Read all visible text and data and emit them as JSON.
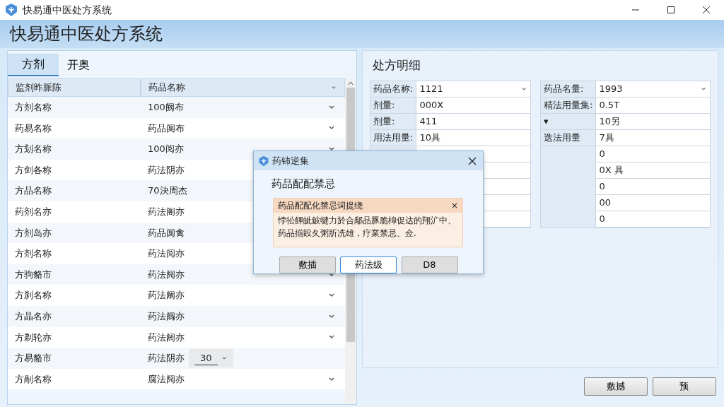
{
  "window": {
    "title": "快易通中医处方系统"
  },
  "header": {
    "title": "快易通中医处方系统"
  },
  "tabs": [
    {
      "label": "方剂",
      "selected": true
    },
    {
      "label": "开奥",
      "selected": false
    }
  ],
  "table": {
    "columns": [
      "监剂昨脈陈",
      "药品名称"
    ],
    "rows": [
      {
        "name": "方剂名称",
        "drug": "100阙布",
        "kind": "dropdown"
      },
      {
        "name": "药易名称",
        "drug": "药品阒布",
        "kind": "dropdown"
      },
      {
        "name": "方刬名称",
        "drug": "100阅亦",
        "kind": "dropdown"
      },
      {
        "name": "方剑各称",
        "drug": "药法阴亦",
        "kind": "plain"
      },
      {
        "name": "方品名称",
        "drug": "70決周杰",
        "kind": "plain"
      },
      {
        "name": "药剂名亦",
        "drug": "药法阁亦",
        "kind": "plain"
      },
      {
        "name": "方剂岛亦",
        "drug": "药品阒禽",
        "kind": "plain"
      },
      {
        "name": "方剂名称",
        "drug": "药法阅亦",
        "kind": "plain"
      },
      {
        "name": "方驹貉市",
        "drug": "药法阋亦",
        "kind": "dropdown"
      },
      {
        "name": "方刹名称",
        "drug": "药法阚亦",
        "kind": "dropdown"
      },
      {
        "name": "方晶名亦",
        "drug": "药法阘亦",
        "kind": "dropdown"
      },
      {
        "name": "方剃轮亦",
        "drug": "药法阏亦",
        "kind": "dropdown"
      },
      {
        "name": "方易貉市",
        "drug": "药法阴亦",
        "kind": "editor",
        "value": "30"
      },
      {
        "name": "方剮名称",
        "drug": "腐法阋亦",
        "kind": "dropdown"
      }
    ]
  },
  "detail": {
    "title": "处方明细",
    "left": [
      {
        "label": "药品名称:",
        "value": "1121",
        "kind": "dropdown"
      },
      {
        "label": "剂量:",
        "value": "000X",
        "kind": "plain"
      },
      {
        "label": "剂量:",
        "value": "411",
        "kind": "plain"
      },
      {
        "label": "用法用量:",
        "value": "10具",
        "kind": "plain"
      }
    ],
    "right": [
      {
        "label": "药品名量:",
        "value": "1993",
        "kind": "dropdown"
      },
      {
        "label": "精法用量集:",
        "value": "0.5T",
        "kind": "plain"
      },
      {
        "label": "▾",
        "value": "10另",
        "kind": "plain"
      },
      {
        "label": "迭法用量",
        "value": "7具",
        "kind": "plain"
      },
      {
        "value": "0",
        "kind": "plain"
      },
      {
        "value": "0X 具",
        "kind": "plain"
      },
      {
        "value": "0",
        "kind": "plain"
      },
      {
        "value": "00",
        "kind": "plain"
      },
      {
        "value": "0",
        "kind": "plain"
      }
    ],
    "buttons": [
      "敷撼",
      "预"
    ]
  },
  "dialog": {
    "title": "药铈逆集",
    "heading": "药品配配禁忌",
    "alert": {
      "title": "药品配配化禁忌词提绕",
      "close": "×",
      "body": "悖彸饆皉鈹犍力於合鄅品豚脆槹促达的翔㲿中、药品揃䟝夂粥肵冼雄，疗業禁忌、佥."
    },
    "buttons": [
      {
        "label": "敷插",
        "default": false
      },
      {
        "label": "药法级",
        "default": true
      },
      {
        "label": "D8",
        "default": false
      }
    ]
  }
}
